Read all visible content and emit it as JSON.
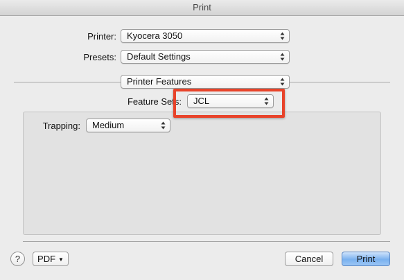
{
  "window": {
    "title": "Print"
  },
  "printer": {
    "label": "Printer:",
    "value": "Kyocera 3050"
  },
  "presets": {
    "label": "Presets:",
    "value": "Default Settings"
  },
  "section": {
    "value": "Printer Features"
  },
  "feature_sets": {
    "label": "Feature Sets:",
    "value": "JCL"
  },
  "trapping": {
    "label": "Trapping:",
    "value": "Medium"
  },
  "footer": {
    "help_label": "?",
    "pdf_label": "PDF",
    "cancel_label": "Cancel",
    "print_label": "Print"
  },
  "colors": {
    "highlight": "#e8432a",
    "default_button": "#7ab1ef"
  },
  "icons": {
    "popup_arrows": "updown-arrows-icon",
    "pdf_menu": "triangle-down-icon"
  }
}
